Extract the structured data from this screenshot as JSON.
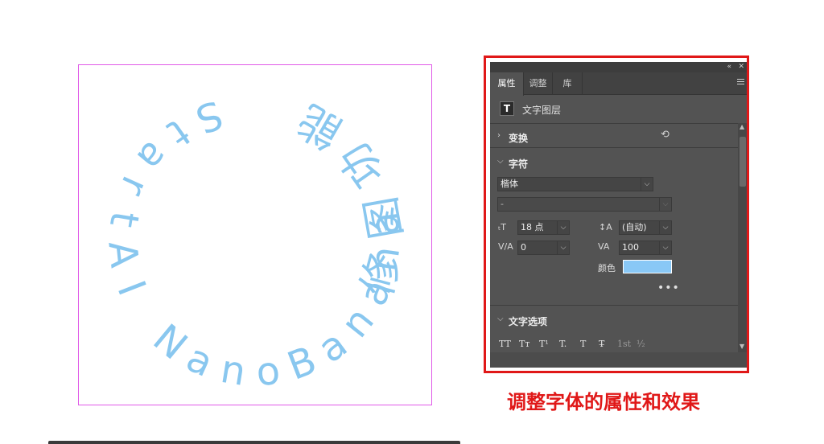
{
  "canvas": {
    "circle_text_1": "StartAI NanoBanana",
    "circle_text_2": "修图功能",
    "text_color": "#89c7ef",
    "artboard_border_color": "#e05ae8"
  },
  "panel": {
    "collapse_icon": "«",
    "close_icon": "✕",
    "tabs": [
      {
        "label": "属性",
        "active": true
      },
      {
        "label": "调整",
        "active": false
      },
      {
        "label": "库",
        "active": false
      }
    ],
    "layer_type_icon": "T",
    "layer_type_label": "文字图层",
    "transform_section": {
      "title": "变换",
      "expanded": false,
      "reset_icon": "⟲"
    },
    "character_section": {
      "title": "字符",
      "expanded": true,
      "font_family": "楷体",
      "font_style": "-",
      "font_size": "18 点",
      "leading": "(自动)",
      "kerning": "0",
      "tracking": "100",
      "color_label": "颜色",
      "color_value": "#89c8f6",
      "more_icon": "•••"
    },
    "text_options_section": {
      "title": "文字选项",
      "expanded": true,
      "options": [
        "TT",
        "Tт",
        "T¹",
        "T.",
        "T",
        "T̶",
        "1st",
        "½"
      ]
    }
  },
  "caption": "调整字体的属性和效果",
  "highlight_color": "#e01818"
}
